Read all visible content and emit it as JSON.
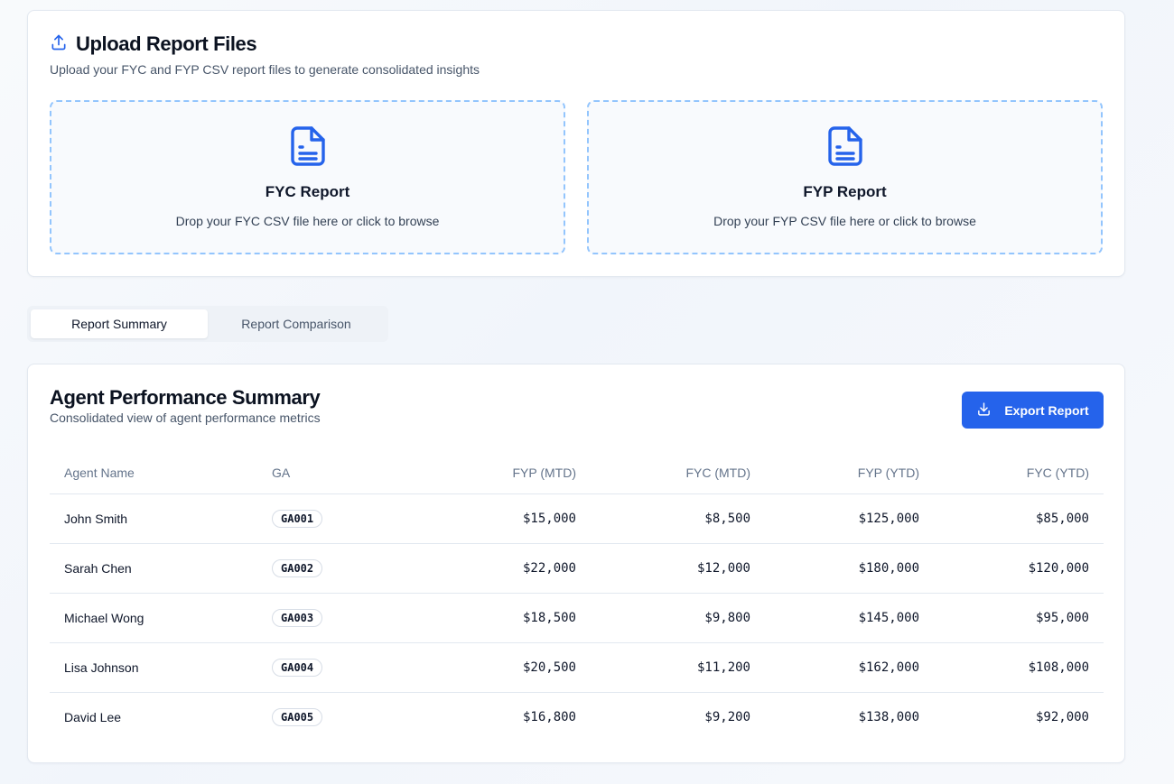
{
  "upload": {
    "title": "Upload Report Files",
    "description": "Upload your FYC and FYP CSV report files to generate consolidated insights",
    "dropzones": [
      {
        "title": "FYC Report",
        "text": "Drop your FYC CSV file here or click to browse"
      },
      {
        "title": "FYP Report",
        "text": "Drop your FYP CSV file here or click to browse"
      }
    ]
  },
  "tabs": [
    {
      "label": "Report Summary",
      "active": true
    },
    {
      "label": "Report Comparison",
      "active": false
    }
  ],
  "summary": {
    "title": "Agent Performance Summary",
    "description": "Consolidated view of agent performance metrics",
    "export_label": "Export Report",
    "columns": [
      "Agent Name",
      "GA",
      "FYP (MTD)",
      "FYC (MTD)",
      "FYP (YTD)",
      "FYC (YTD)"
    ],
    "rows": [
      {
        "name": "John Smith",
        "ga": "GA001",
        "fyp_mtd": "$15,000",
        "fyc_mtd": "$8,500",
        "fyp_ytd": "$125,000",
        "fyc_ytd": "$85,000"
      },
      {
        "name": "Sarah Chen",
        "ga": "GA002",
        "fyp_mtd": "$22,000",
        "fyc_mtd": "$12,000",
        "fyp_ytd": "$180,000",
        "fyc_ytd": "$120,000"
      },
      {
        "name": "Michael Wong",
        "ga": "GA003",
        "fyp_mtd": "$18,500",
        "fyc_mtd": "$9,800",
        "fyp_ytd": "$145,000",
        "fyc_ytd": "$95,000"
      },
      {
        "name": "Lisa Johnson",
        "ga": "GA004",
        "fyp_mtd": "$20,500",
        "fyc_mtd": "$11,200",
        "fyp_ytd": "$162,000",
        "fyc_ytd": "$108,000"
      },
      {
        "name": "David Lee",
        "ga": "GA005",
        "fyp_mtd": "$16,800",
        "fyc_mtd": "$9,200",
        "fyp_ytd": "$138,000",
        "fyc_ytd": "$92,000"
      }
    ]
  },
  "colors": {
    "accent": "#2563eb",
    "dropzone_border": "#93c5fd",
    "icon": "#2563eb"
  },
  "icons": {
    "upload": "upload-icon",
    "file": "file-text-icon",
    "download": "download-icon"
  }
}
